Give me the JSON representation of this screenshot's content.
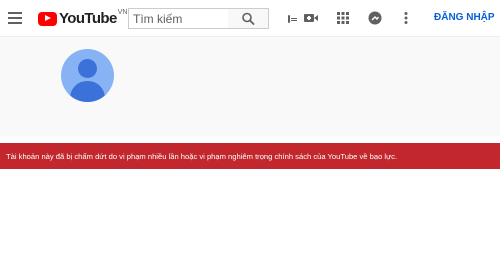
{
  "header": {
    "logo_text": "YouTube",
    "region": "VN",
    "search_placeholder": "Tìm kiếm",
    "signin_label": "ĐĂNG NHẬP"
  },
  "icons": {
    "menu": "hamburger-menu-icon",
    "keyboard": "keyboard-icon",
    "search": "search-icon",
    "create": "video-camera-icon",
    "apps": "apps-grid-icon",
    "messages": "messages-icon",
    "more": "more-vert-icon",
    "avatar": "default-avatar-icon"
  },
  "alert": {
    "message": "Tài khoản này đã bị chấm dứt do vi phạm nhiều lần hoặc vi phạm nghiêm trọng chính sách của YouTube về bạo lực."
  },
  "colors": {
    "brand": "#ff0000",
    "link": "#065fd4",
    "alert_bg": "#c1272d",
    "avatar_bg": "#87b3f5",
    "avatar_fg": "#3a72d9"
  }
}
